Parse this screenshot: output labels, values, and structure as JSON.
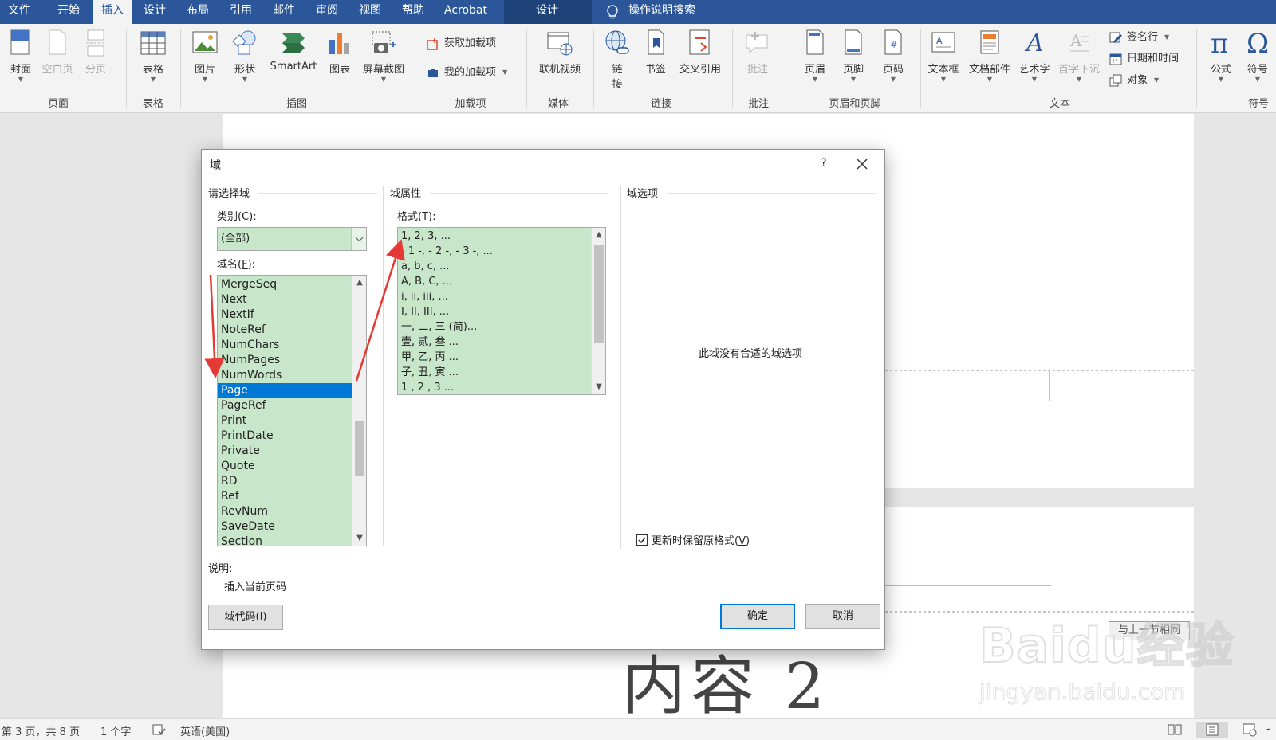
{
  "menu": {
    "tabs": [
      "文件",
      "开始",
      "插入",
      "设计",
      "布局",
      "引用",
      "邮件",
      "审阅",
      "视图",
      "帮助",
      "Acrobat"
    ],
    "active_tab": "插入",
    "context_tab": "设计",
    "tell_me": "操作说明搜索"
  },
  "ribbon": {
    "groups": {
      "pages": "页面",
      "tables": "表格",
      "illustrations": "插图",
      "addins": "加载项",
      "media": "媒体",
      "links": "链接",
      "comments": "批注",
      "header_footer": "页眉和页脚",
      "text": "文本",
      "symbols": "符号"
    },
    "buttons": {
      "cover": "封面",
      "blank_page": "空白页",
      "page_break": "分页",
      "table": "表格",
      "picture": "图片",
      "shapes": "形状",
      "smartart": "SmartArt",
      "chart": "图表",
      "screenshot": "屏幕截图",
      "get_addins": "获取加载项",
      "my_addins": "我的加载项",
      "online_video": "联机视频",
      "link_1": "链",
      "link_2": "接",
      "bookmark": "书签",
      "cross_ref": "交叉引用",
      "comment": "批注",
      "header": "页眉",
      "footer": "页脚",
      "page_number": "页码",
      "textbox": "文本框",
      "quick_parts": "文档部件",
      "wordart": "艺术字",
      "drop_cap": "首字下沉",
      "signature_line": "签名行",
      "date_time": "日期和时间",
      "object": "对象",
      "equation": "公式",
      "symbol": "符号"
    }
  },
  "dialog": {
    "title": "域",
    "help": "?",
    "choose_section": "请选择域",
    "category_label": "类别",
    "category_key": "C",
    "category_value": "(全部)",
    "field_names_label": "域名",
    "field_names_key": "F",
    "field_names": [
      "MergeSeq",
      "Next",
      "NextIf",
      "NoteRef",
      "NumChars",
      "NumPages",
      "NumWords",
      "Page",
      "PageRef",
      "Print",
      "PrintDate",
      "Private",
      "Quote",
      "RD",
      "Ref",
      "RevNum",
      "SaveDate",
      "Section"
    ],
    "selected_field": "Page",
    "properties_section": "域属性",
    "format_label": "格式",
    "format_key": "T",
    "formats": [
      "1, 2, 3, ...",
      "- 1 -, - 2 -, - 3 -, ...",
      "a, b, c, ...",
      "A, B, C, ...",
      "i, ii, iii, ...",
      "I, II, III, ...",
      "一, 二, 三 (简)...",
      "壹, 贰, 叁 ...",
      "甲, 乙, 丙 ...",
      "子, 丑, 寅 ...",
      "1 , 2 , 3 ..."
    ],
    "options_section": "域选项",
    "no_options": "此域没有合适的域选项",
    "preserve_format": "更新时保留原格式",
    "preserve_key": "V",
    "preserve_checked": true,
    "description_label": "说明:",
    "description": "插入当前页码",
    "field_codes_button": "域代码(I)",
    "ok_button": "确定",
    "cancel_button": "取消"
  },
  "document": {
    "big_text": "内容 2",
    "same_as_previous": "与上一节相同"
  },
  "status": {
    "page": "第 3 页，共 8 页",
    "words": "1 个字",
    "language": "英语(美国)"
  },
  "watermark": {
    "main": "Baidu经验",
    "sub": "jingyan.baidu.com"
  },
  "colors": {
    "ribbon_blue": "#2b579a",
    "list_green": "#c8e6c9",
    "selection_blue": "#0078d7",
    "annotation_red": "#e53935"
  }
}
